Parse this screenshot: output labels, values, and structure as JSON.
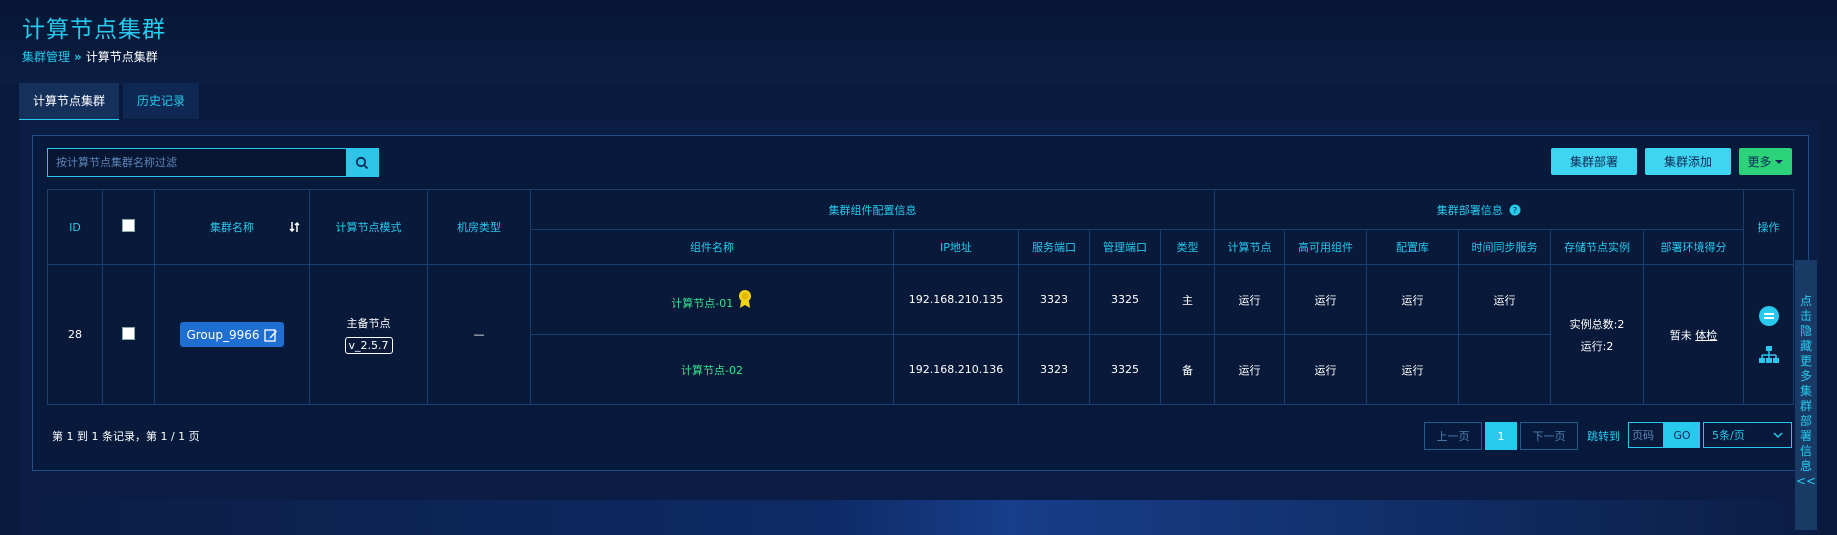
{
  "header": {
    "title": "计算节点集群",
    "breadcrumb": {
      "parent": "集群管理",
      "separator": "»",
      "current": "计算节点集群"
    }
  },
  "tabs": [
    {
      "label": "计算节点集群",
      "active": true
    },
    {
      "label": "历史记录",
      "active": false
    }
  ],
  "toolbar": {
    "search_placeholder": "按计算节点集群名称过滤",
    "search_icon": "search-icon",
    "deploy_label": "集群部署",
    "add_label": "集群添加",
    "more_label": "更多",
    "more_icon": "caret-down-icon"
  },
  "table": {
    "headers": {
      "id": "ID",
      "cluster_name": "集群名称",
      "mode": "计算节点模式",
      "room_type": "机房类型",
      "component_group": "集群组件配置信息",
      "deploy_group": "集群部署信息",
      "operation": "操作",
      "component_name": "组件名称",
      "ip": "IP地址",
      "service_port": "服务端口",
      "manage_port": "管理端口",
      "type": "类型",
      "compute_node": "计算节点",
      "ha_component": "高可用组件",
      "config_db": "配置库",
      "time_sync": "时间同步服务",
      "storage_instance": "存储节点实例",
      "env_score": "部署环境得分"
    },
    "row": {
      "id": "28",
      "cluster_name": "Group_9966",
      "mode_line1": "主备节点",
      "version": "v_2.5.7",
      "room_type": "—",
      "storage_total": "实例总数:2",
      "storage_running": "运行:2",
      "env_score_text": "暂未",
      "env_score_link": "体检",
      "components": [
        {
          "name": "计算节点-01",
          "ip": "192.168.210.135",
          "service_port": "3323",
          "manage_port": "3325",
          "type": "主",
          "compute": "运行",
          "ha": "运行",
          "config": "运行",
          "sync": "运行",
          "badge": "medal-icon"
        },
        {
          "name": "计算节点-02",
          "ip": "192.168.210.136",
          "service_port": "3323",
          "manage_port": "3325",
          "type": "备",
          "compute": "运行",
          "ha": "运行",
          "config": "运行",
          "sync": ""
        }
      ]
    }
  },
  "pagination": {
    "summary": "第 1 到 1 条记录，第 1 / 1 页",
    "prev": "上一页",
    "current": "1",
    "next": "下一页",
    "jump_label": "跳转到",
    "page_placeholder": "页码",
    "go": "GO",
    "page_size": "5条/页"
  },
  "side_toggle": {
    "chars": [
      "点",
      "击",
      "隐",
      "藏",
      "更",
      "多",
      "集",
      "群",
      "部",
      "署",
      "信",
      "息",
      "<<"
    ]
  },
  "colors": {
    "accent": "#27c9ec",
    "button_cyan": "#3fd4ef",
    "button_green": "#2cd279",
    "running_green": "#3be28b",
    "background": "#0a1a3c"
  }
}
